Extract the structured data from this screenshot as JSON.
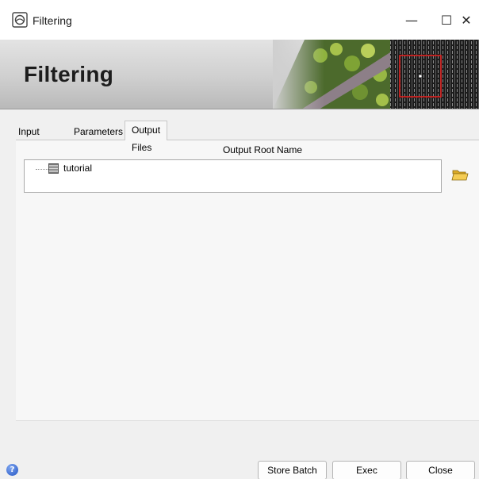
{
  "window": {
    "title": "Filtering",
    "minimize_glyph": "—",
    "maximize_glyph": "☐",
    "close_glyph": "✕"
  },
  "banner": {
    "title": "Filtering"
  },
  "tabs": [
    {
      "label": "Input Files",
      "active": false
    },
    {
      "label": "Parameters",
      "active": false
    },
    {
      "label": "Output Files",
      "active": true
    }
  ],
  "output": {
    "section_label": "Output Root Name",
    "tree_items": [
      {
        "label": "tutorial",
        "icon": "raster-image-icon"
      }
    ],
    "browse_icon": "folder-open-icon"
  },
  "footer": {
    "help_glyph": "?",
    "store_batch_label": "Store Batch",
    "exec_label": "Exec",
    "close_label": "Close"
  },
  "colors": {
    "accent_red_frame": "#e0201e",
    "banner_gradient_top": "#e3e3e3",
    "banner_gradient_bottom": "#b9b9b9",
    "help_blue": "#2456c4"
  }
}
